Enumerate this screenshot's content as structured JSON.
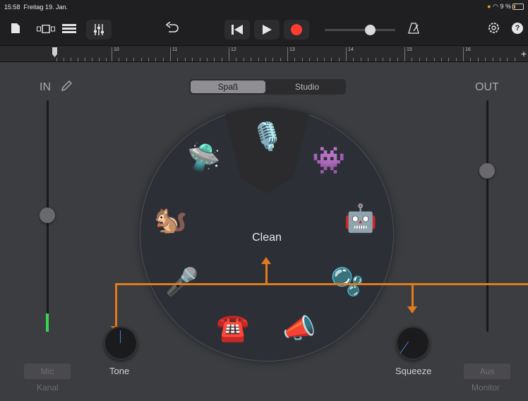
{
  "status": {
    "time": "15:58",
    "date": "Freitag 19. Jan.",
    "battery": "9 %"
  },
  "toolbar": {
    "icons": [
      "document-icon",
      "tracks-view-icon",
      "list-view-icon",
      "mixer-icon",
      "undo-icon",
      "rewind-icon",
      "play-icon",
      "record-icon",
      "metronome-icon",
      "settings-icon",
      "help-icon"
    ],
    "help_label": "?"
  },
  "ruler": {
    "bars": [
      "10",
      "11",
      "12",
      "13",
      "14",
      "15",
      "16"
    ],
    "add": "+"
  },
  "mode": {
    "tabs": [
      "Spaß",
      "Studio"
    ],
    "selected": "Spaß"
  },
  "input": {
    "label": "IN"
  },
  "output": {
    "label": "OUT"
  },
  "voice_dial": {
    "center_label": "Clean",
    "voices": [
      "ufo",
      "microphone",
      "monster",
      "squirrel",
      "robot",
      "karaoke-mic",
      "bubbles",
      "telephone",
      "megaphone"
    ]
  },
  "knobs": {
    "tone": "Tone",
    "squeeze": "Squeeze"
  },
  "buttons": {
    "mic": "Mic",
    "kanal": "Kanal",
    "aus": "Aus",
    "monitor": "Monitor"
  },
  "colors": {
    "accent": "#e07b1e",
    "record": "#ff3b30",
    "level": "#39d353"
  }
}
